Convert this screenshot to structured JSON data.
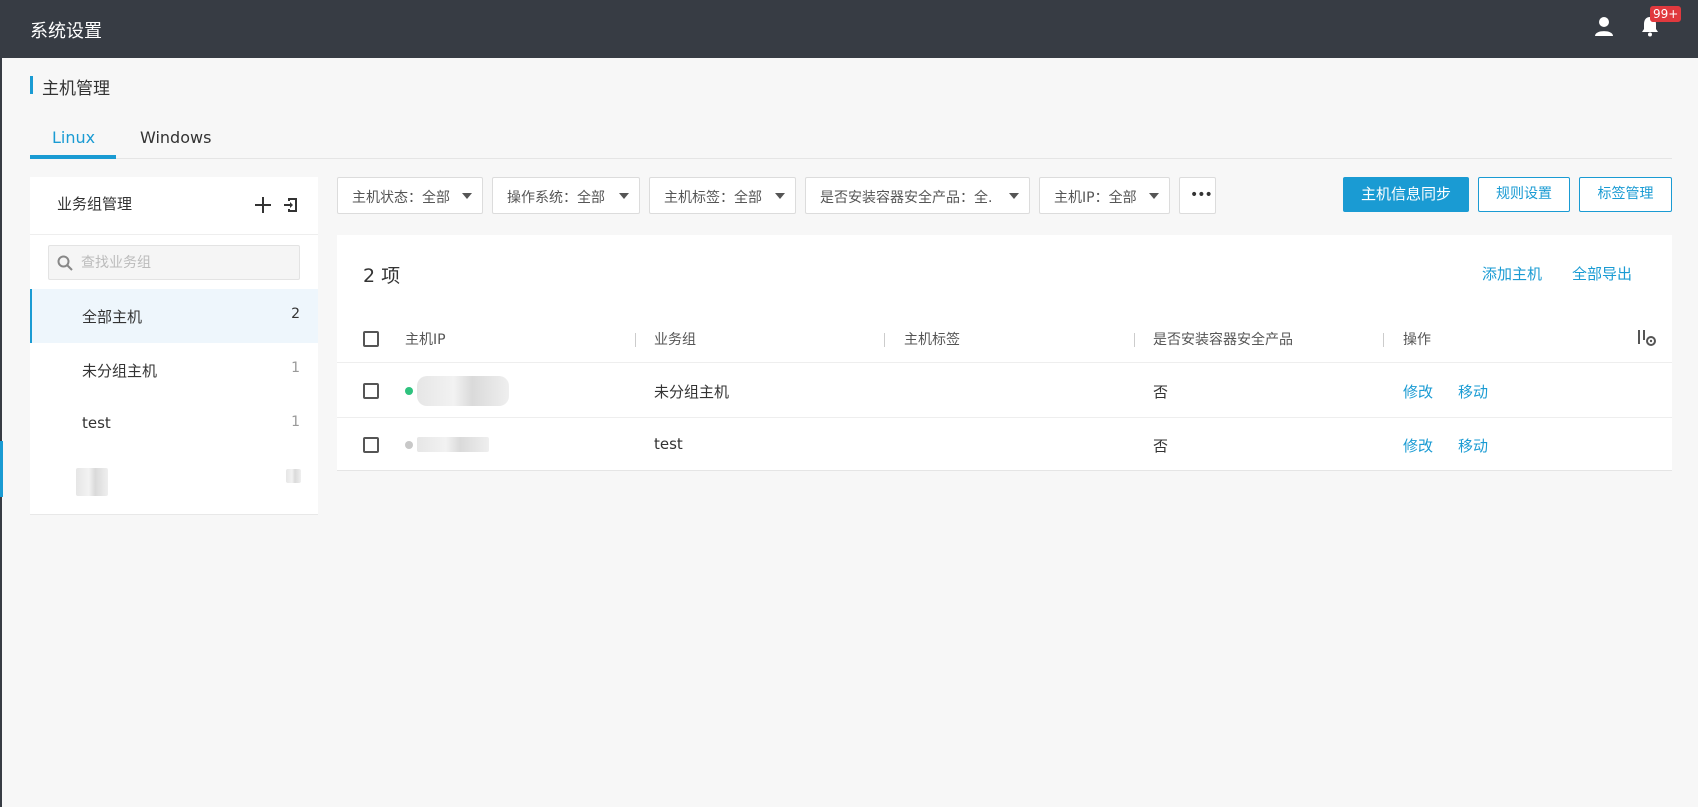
{
  "header": {
    "title": "系统设置",
    "notification_count": "99+"
  },
  "page": {
    "title": "主机管理"
  },
  "tabs": [
    {
      "label": "Linux",
      "active": true
    },
    {
      "label": "Windows",
      "active": false
    }
  ],
  "sidebar": {
    "title": "业务组管理",
    "search_placeholder": "查找业务组",
    "items": [
      {
        "label": "全部主机",
        "count": "2",
        "active": true
      },
      {
        "label": "未分组主机",
        "count": "1"
      },
      {
        "label": "test",
        "count": "1"
      }
    ]
  },
  "filters": [
    {
      "label": "主机状态：全部"
    },
    {
      "label": "操作系统：全部"
    },
    {
      "label": "主机标签：全部"
    },
    {
      "label": "是否安装容器安全产品：全."
    },
    {
      "label": "主机IP：全部"
    }
  ],
  "more_label": "•••",
  "actions": {
    "sync": "主机信息同步",
    "rules": "规则设置",
    "tags": "标签管理"
  },
  "table": {
    "count_label": "2 项",
    "add_host": "添加主机",
    "export_all": "全部导出",
    "columns": [
      "主机IP",
      "业务组",
      "主机标签",
      "是否安装容器安全产品",
      "操作"
    ],
    "rows": [
      {
        "status_color": "#2ec27e",
        "group": "未分组主机",
        "tags": "",
        "container_security": "否",
        "edit": "修改",
        "move": "移动"
      },
      {
        "status_color": "#c8c8c8",
        "group": "test",
        "tags": "",
        "container_security": "否",
        "edit": "修改",
        "move": "移动"
      }
    ]
  },
  "colors": {
    "accent": "#1a9bd3",
    "topbar": "#373c44",
    "badge": "#e0393e"
  }
}
